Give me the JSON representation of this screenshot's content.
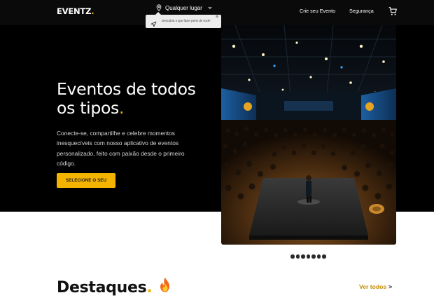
{
  "brand": {
    "name": "EVENTZ",
    "dot": "."
  },
  "header": {
    "location_label": "Qualquer lugar",
    "create_event": "Crie seu Evento",
    "security": "Segurança"
  },
  "tooltip": {
    "text": "Descubra o que fazer perto de você!",
    "close": "⊗"
  },
  "hero": {
    "title_line1": "Eventos de todos",
    "title_line2": "os tipos",
    "title_dot": ".",
    "description": "Conecte-se, compartilhe e celebre momentos inesquecíveis com nosso aplicativo de eventos personalizado, feito com paixão desde o primeiro código.",
    "cta_label": "SELECIONE O SEU"
  },
  "carousel": {
    "slide_count": 7,
    "active_index": 0
  },
  "highlights": {
    "title": "Destaques",
    "title_dot": ".",
    "see_all": "Ver todos",
    "see_all_chevron": ">"
  },
  "colors": {
    "accent": "#f5b301",
    "header_bg": "#0a0a0a",
    "link": "#c48a00"
  },
  "icons": [
    "location-pin-icon",
    "chevron-down-icon",
    "cart-icon",
    "navigation-arrow-icon",
    "close-icon",
    "fire-emoji-icon"
  ]
}
